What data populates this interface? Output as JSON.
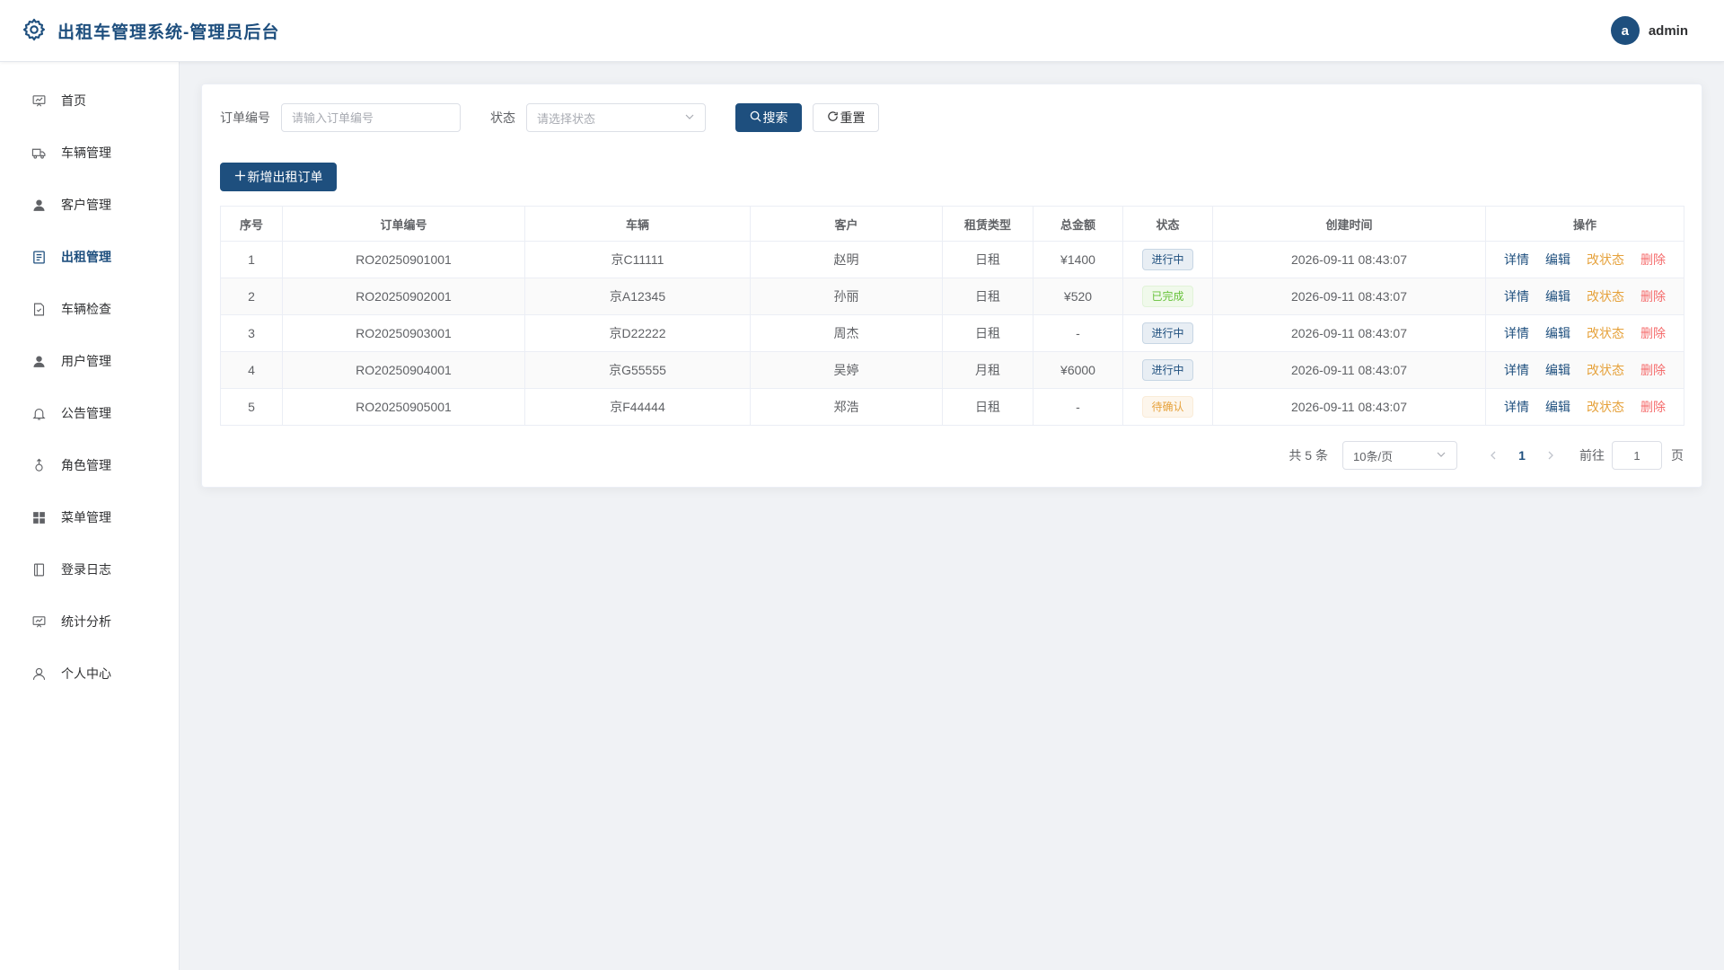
{
  "app": {
    "title": "出租车管理系统-管理员后台",
    "user_initial": "a",
    "username": "admin",
    "accent": "#1e4f7e"
  },
  "sidebar": {
    "items": [
      {
        "label": "首页",
        "icon": "dashboard-icon"
      },
      {
        "label": "车辆管理",
        "icon": "truck-icon"
      },
      {
        "label": "客户管理",
        "icon": "user-icon"
      },
      {
        "label": "出租管理",
        "icon": "document-icon"
      },
      {
        "label": "车辆检查",
        "icon": "document-check-icon"
      },
      {
        "label": "用户管理",
        "icon": "user-icon"
      },
      {
        "label": "公告管理",
        "icon": "bell-icon"
      },
      {
        "label": "角色管理",
        "icon": "female-icon"
      },
      {
        "label": "菜单管理",
        "icon": "grid-icon"
      },
      {
        "label": "登录日志",
        "icon": "notebook-icon"
      },
      {
        "label": "统计分析",
        "icon": "presentation-icon"
      },
      {
        "label": "个人中心",
        "icon": "user-outline-icon"
      }
    ],
    "active_index": 3
  },
  "search": {
    "order_no_label": "订单编号",
    "order_no_placeholder": "请输入订单编号",
    "status_label": "状态",
    "status_placeholder": "请选择状态",
    "search_label": "搜索",
    "reset_label": "重置"
  },
  "toolbar": {
    "add_label": "新增出租订单"
  },
  "table": {
    "columns": [
      "序号",
      "订单编号",
      "车辆",
      "客户",
      "租赁类型",
      "总金额",
      "状态",
      "创建时间",
      "操作"
    ],
    "actions": {
      "detail": "详情",
      "edit": "编辑",
      "status": "改状态",
      "delete": "删除"
    },
    "rows": [
      {
        "idx": "1",
        "order_no": "RO20250901001",
        "vehicle": "京C11111",
        "customer": "赵明",
        "type": "日租",
        "amount": "¥1400",
        "status": "进行中",
        "status_kind": "ongoing",
        "created": "2026-09-11 08:43:07"
      },
      {
        "idx": "2",
        "order_no": "RO20250902001",
        "vehicle": "京A12345",
        "customer": "孙丽",
        "type": "日租",
        "amount": "¥520",
        "status": "已完成",
        "status_kind": "done",
        "created": "2026-09-11 08:43:07"
      },
      {
        "idx": "3",
        "order_no": "RO20250903001",
        "vehicle": "京D22222",
        "customer": "周杰",
        "type": "日租",
        "amount": "-",
        "status": "进行中",
        "status_kind": "ongoing",
        "created": "2026-09-11 08:43:07"
      },
      {
        "idx": "4",
        "order_no": "RO20250904001",
        "vehicle": "京G55555",
        "customer": "吴婷",
        "type": "月租",
        "amount": "¥6000",
        "status": "进行中",
        "status_kind": "ongoing",
        "created": "2026-09-11 08:43:07"
      },
      {
        "idx": "5",
        "order_no": "RO20250905001",
        "vehicle": "京F44444",
        "customer": "郑浩",
        "type": "日租",
        "amount": "-",
        "status": "待确认",
        "status_kind": "pending",
        "created": "2026-09-11 08:43:07"
      }
    ]
  },
  "pagination": {
    "total_text": "共 5 条",
    "page_size": "10条/页",
    "current_page": "1",
    "goto_label": "前往",
    "goto_value": "1",
    "goto_unit": "页"
  }
}
